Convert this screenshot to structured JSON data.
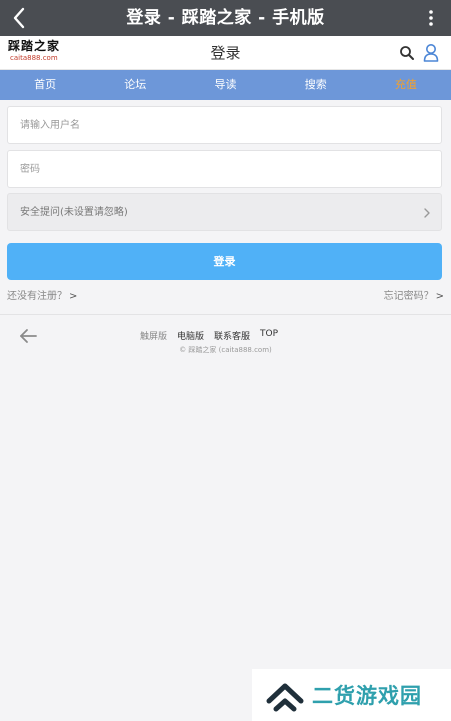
{
  "titlebar": {
    "title": "登录 - 踩踏之家 - 手机版",
    "back_icon": "chevron-left-icon",
    "more_icon": "more-vertical-icon"
  },
  "header": {
    "logo_main": "踩踏之家",
    "logo_sub": "caita888.com",
    "page_title": "登录",
    "search_icon": "search-icon",
    "user_icon": "user-icon",
    "accent": "#4c86d6"
  },
  "nav": {
    "bg": "#6d97d9",
    "items": [
      {
        "label": "首页"
      },
      {
        "label": "论坛"
      },
      {
        "label": "导读"
      },
      {
        "label": "搜索"
      },
      {
        "label": "充值",
        "color": "#f4a12b"
      }
    ]
  },
  "form": {
    "username": {
      "value": "",
      "placeholder": "请输入用户名"
    },
    "password": {
      "value": "",
      "placeholder": "密码"
    },
    "security_question": {
      "selected": "安全提问(未设置请忽略)"
    },
    "login_label": "登录",
    "login_color": "#50b1f7",
    "register_link": "还没有注册？",
    "forgot_link": "忘记密码？"
  },
  "footer": {
    "links": [
      "触屏版",
      "电脑版",
      "联系客服",
      "TOP"
    ],
    "copyright": "© 踩踏之家 (caita888.com)"
  },
  "watermark": {
    "text": "二货游戏园",
    "color": "#2fa0ad"
  }
}
